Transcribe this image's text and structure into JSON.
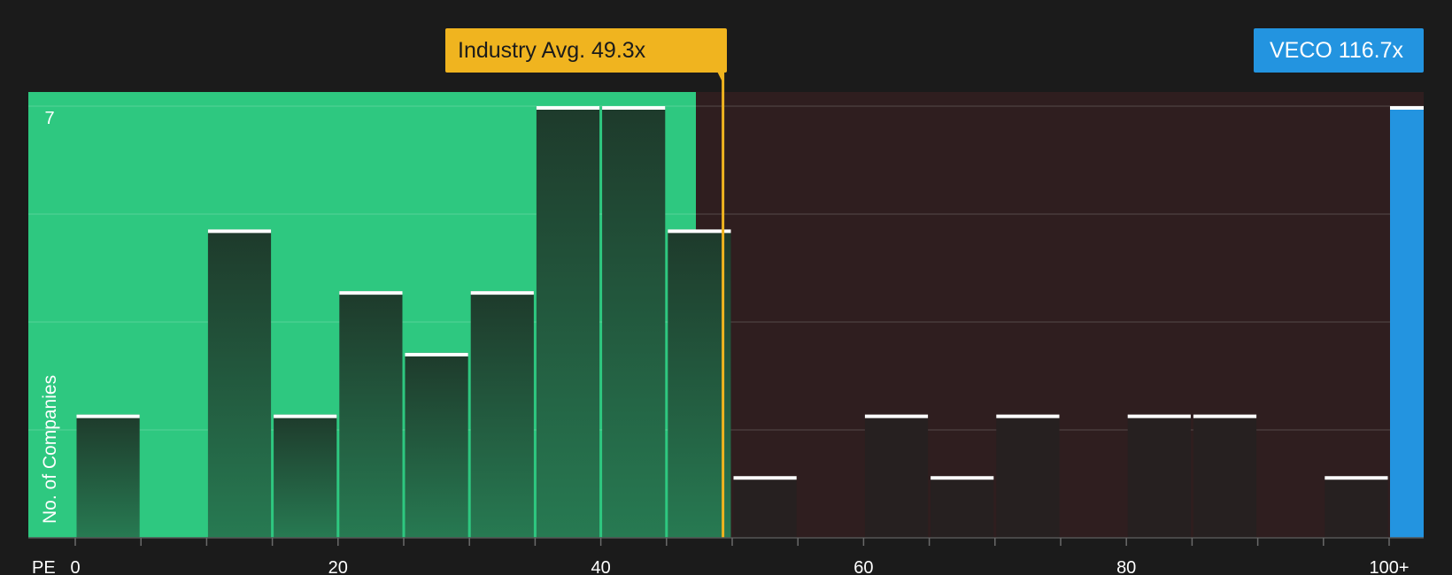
{
  "colors": {
    "background": "#1b1b1b",
    "below_zone": "#2ec880",
    "above_zone": "#2f1e1f",
    "bar_dark": "#1f3d2e",
    "bar_above": "#262020",
    "average_line": "#f0b41f",
    "company_bar": "#2394e0",
    "text": "#ffffff"
  },
  "callouts": {
    "industry_avg_label": "Industry Avg. 49.3x",
    "company_label": "VECO 116.7x"
  },
  "chart_data": {
    "type": "bar",
    "xlabel": "PE",
    "ylabel": "No. of Companies",
    "y_tick_labels": [
      "7"
    ],
    "ylim": [
      0,
      7
    ],
    "x_ticks": [
      0,
      20,
      40,
      60,
      80,
      100
    ],
    "x_tick_labels": [
      "0",
      "20",
      "40",
      "60",
      "80",
      "100+"
    ],
    "xlim": [
      0,
      104
    ],
    "bin_width": 5,
    "bins": [
      {
        "start": 0,
        "count": 2
      },
      {
        "start": 10,
        "count": 5
      },
      {
        "start": 15,
        "count": 2
      },
      {
        "start": 20,
        "count": 4
      },
      {
        "start": 25,
        "count": 3
      },
      {
        "start": 30,
        "count": 4
      },
      {
        "start": 35,
        "count": 7
      },
      {
        "start": 40,
        "count": 7
      },
      {
        "start": 45,
        "count": 5
      },
      {
        "start": 50,
        "count": 1
      },
      {
        "start": 60,
        "count": 2
      },
      {
        "start": 65,
        "count": 1
      },
      {
        "start": 70,
        "count": 2
      },
      {
        "start": 80,
        "count": 2
      },
      {
        "start": 85,
        "count": 2
      },
      {
        "start": 95,
        "count": 1
      }
    ],
    "industry_average": 49.3,
    "company": {
      "name": "VECO",
      "value": 116.7,
      "count": 7
    }
  }
}
